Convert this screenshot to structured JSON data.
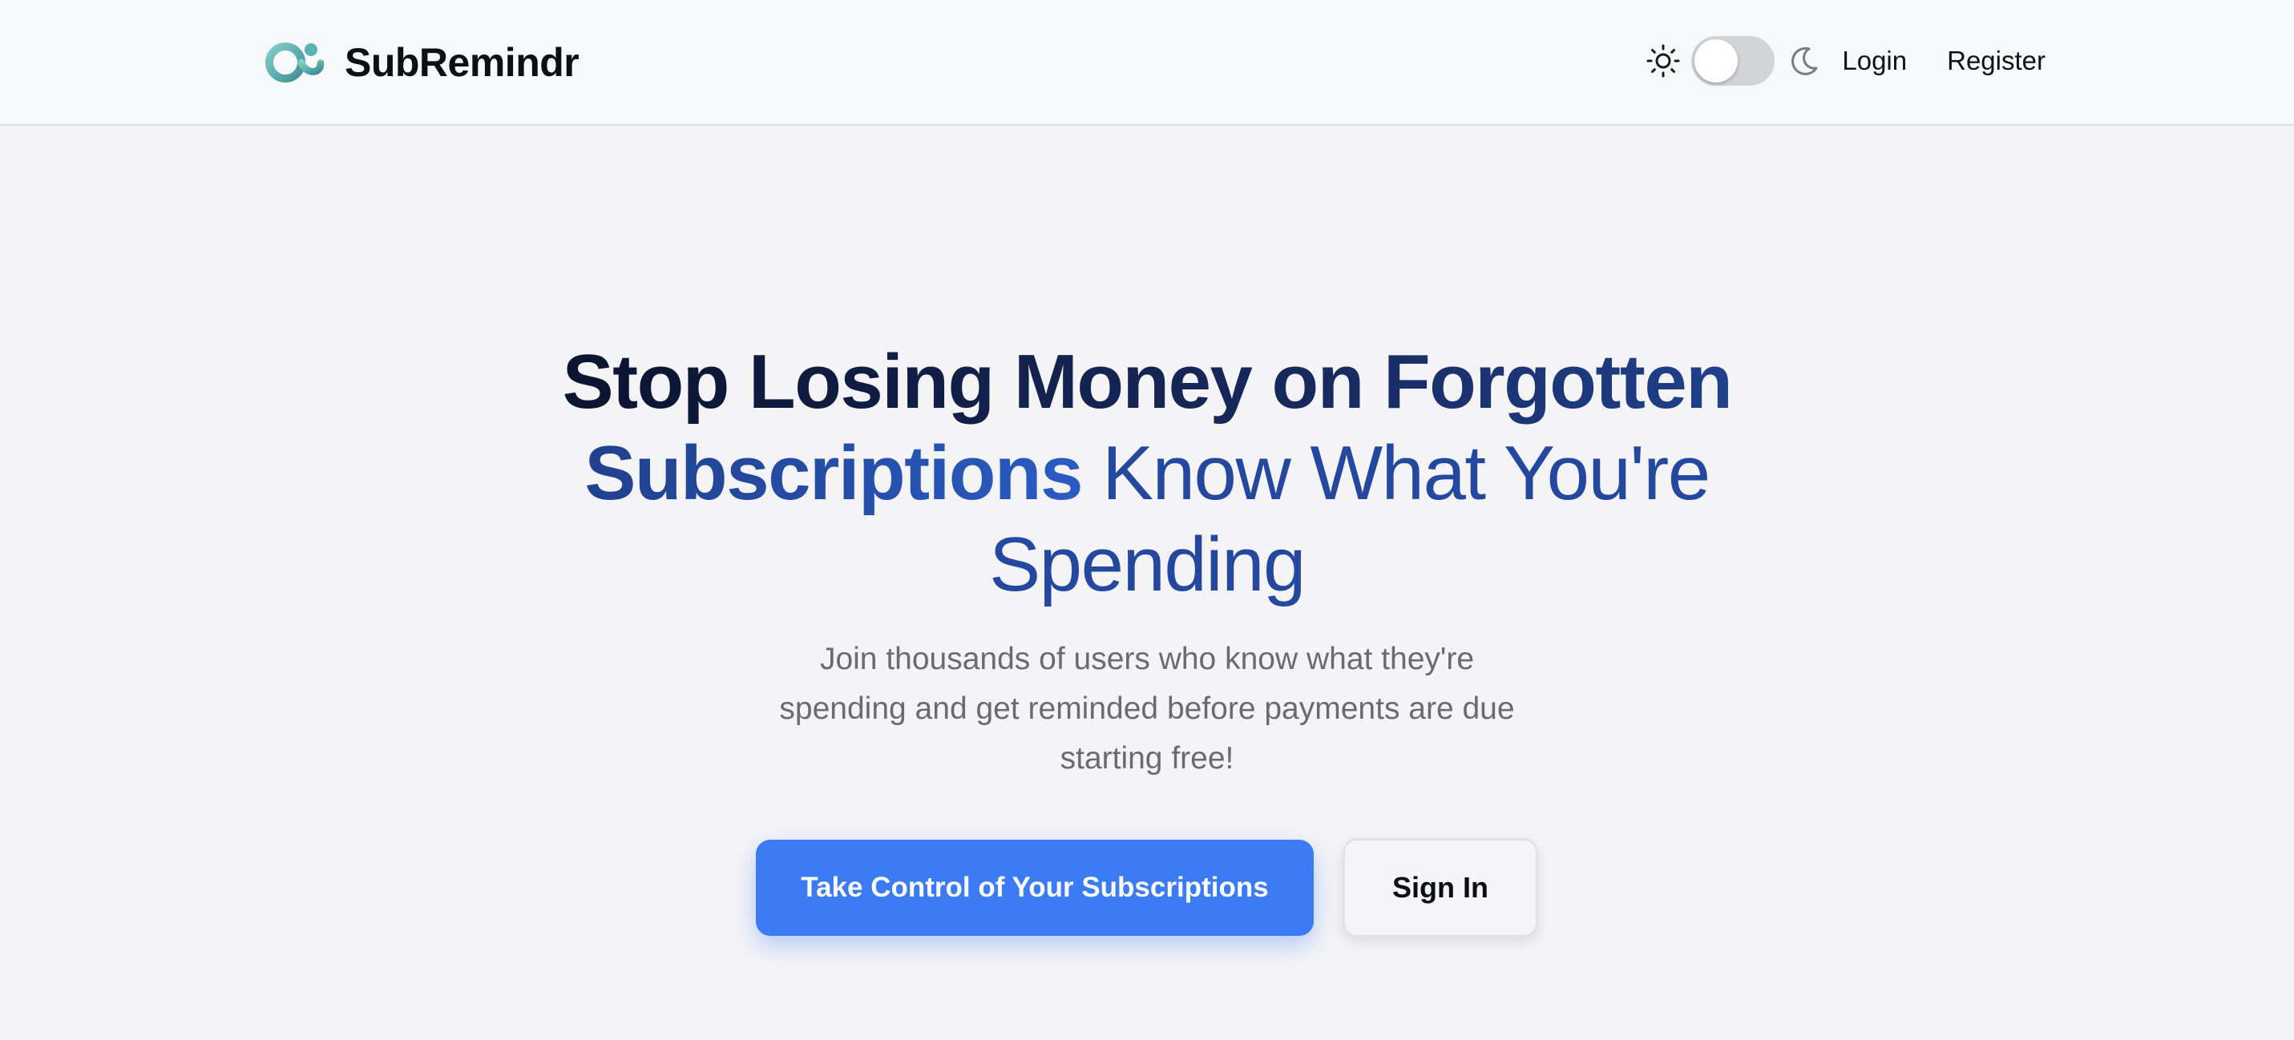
{
  "header": {
    "brand_name": "SubRemindr",
    "logo_icon": "subremindr-logo-icon",
    "theme_toggle": {
      "state": "light",
      "light_icon": "sun-icon",
      "dark_icon": "moon-icon"
    },
    "nav": {
      "login_label": "Login",
      "register_label": "Register"
    }
  },
  "hero": {
    "headline_bold": "Stop Losing Money on Forgotten Subscriptions",
    "headline_light": "Know What You're Spending",
    "subtext": "Join thousands of users who know what they're spending and get reminded before payments are due starting free!",
    "primary_cta": "Take Control of Your Subscriptions",
    "secondary_cta": "Sign In"
  },
  "colors": {
    "accent": "#3b7bf6",
    "headline_dark": "#0b1430",
    "headline_blue": "#24479f",
    "logo_teal": "#5bb3b0"
  }
}
